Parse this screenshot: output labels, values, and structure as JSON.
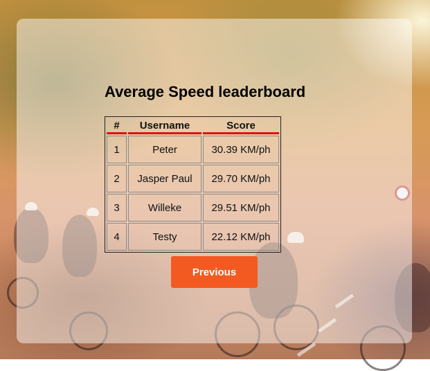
{
  "title": "Average Speed leaderboard",
  "table": {
    "headers": [
      "#",
      "Username",
      "Score"
    ],
    "rows": [
      {
        "rank": "1",
        "username": "Peter",
        "score": "30.39 KM/ph"
      },
      {
        "rank": "2",
        "username": "Jasper Paul",
        "score": "29.70 KM/ph"
      },
      {
        "rank": "3",
        "username": "Willeke",
        "score": "29.51 KM/ph"
      },
      {
        "rank": "4",
        "username": "Testy",
        "score": "22.12 KM/ph"
      }
    ]
  },
  "buttons": {
    "previous_label": "Previous"
  },
  "colors": {
    "accent_button": "#f35a22",
    "header_underline": "#e01010"
  }
}
